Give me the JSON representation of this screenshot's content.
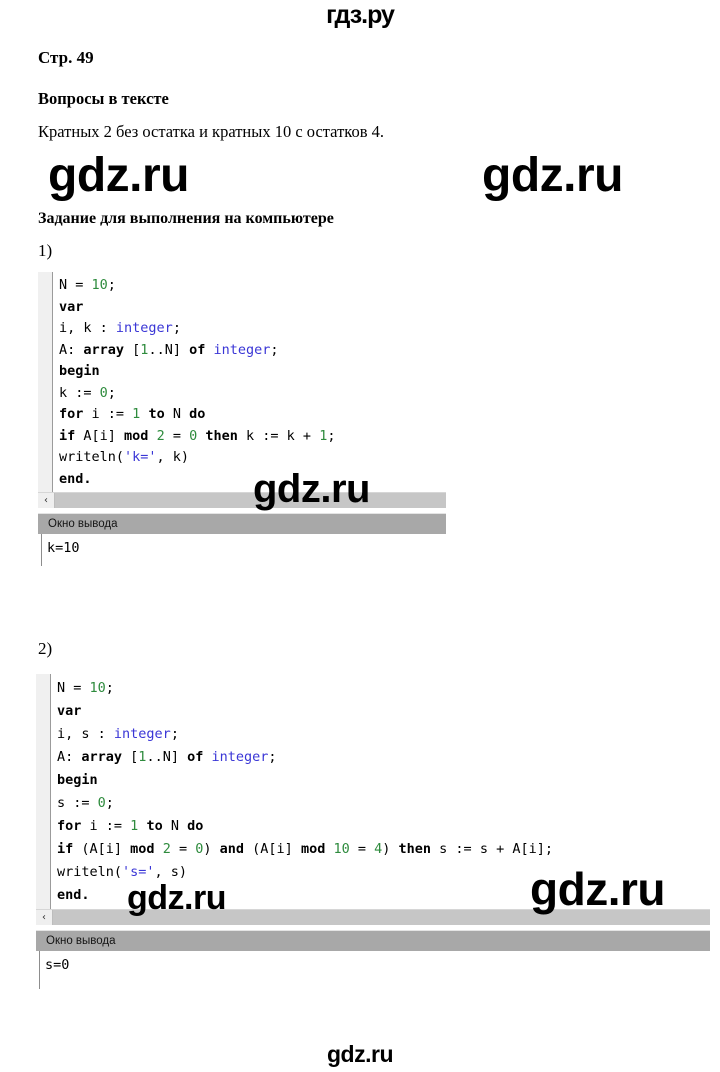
{
  "site": {
    "logo_top": "гдз.ру",
    "watermark": "gdz.ru"
  },
  "document": {
    "page_label": "Стр. 49",
    "heading_questions": "Вопросы в тексте",
    "answer_text": "Кратных 2 без остатка и кратных 10 с остатков 4.",
    "heading_task": "Задание для выполнения на компьютере",
    "item_1_marker": "1)",
    "item_2_marker": "2)"
  },
  "editor_1": {
    "scrollbar_arrow": "‹",
    "output_title": "Окно вывода",
    "output_value": "k=10",
    "code": [
      [
        {
          "t": "N = ",
          "c": "pl"
        },
        {
          "t": "10",
          "c": "num"
        },
        {
          "t": ";",
          "c": "pl"
        }
      ],
      [
        {
          "t": "var",
          "c": "kw"
        }
      ],
      [
        {
          "t": "i, k : ",
          "c": "pl"
        },
        {
          "t": "integer",
          "c": "typ"
        },
        {
          "t": ";",
          "c": "pl"
        }
      ],
      [
        {
          "t": "A: ",
          "c": "pl"
        },
        {
          "t": "array",
          "c": "kw"
        },
        {
          "t": " [",
          "c": "pl"
        },
        {
          "t": "1",
          "c": "num"
        },
        {
          "t": "..N] ",
          "c": "pl"
        },
        {
          "t": "of",
          "c": "kw"
        },
        {
          "t": " ",
          "c": "pl"
        },
        {
          "t": "integer",
          "c": "typ"
        },
        {
          "t": ";",
          "c": "pl"
        }
      ],
      [
        {
          "t": "begin",
          "c": "kw"
        }
      ],
      [
        {
          "t": "k := ",
          "c": "pl"
        },
        {
          "t": "0",
          "c": "num"
        },
        {
          "t": ";",
          "c": "pl"
        }
      ],
      [
        {
          "t": "for",
          "c": "kw"
        },
        {
          "t": " i := ",
          "c": "pl"
        },
        {
          "t": "1",
          "c": "num"
        },
        {
          "t": " ",
          "c": "pl"
        },
        {
          "t": "to",
          "c": "kw"
        },
        {
          "t": " N ",
          "c": "pl"
        },
        {
          "t": "do",
          "c": "kw"
        }
      ],
      [
        {
          "t": "if",
          "c": "kw"
        },
        {
          "t": " A[i] ",
          "c": "pl"
        },
        {
          "t": "mod",
          "c": "kw"
        },
        {
          "t": " ",
          "c": "pl"
        },
        {
          "t": "2",
          "c": "num"
        },
        {
          "t": " = ",
          "c": "pl"
        },
        {
          "t": "0",
          "c": "num"
        },
        {
          "t": " ",
          "c": "pl"
        },
        {
          "t": "then",
          "c": "kw"
        },
        {
          "t": " k := k + ",
          "c": "pl"
        },
        {
          "t": "1",
          "c": "num"
        },
        {
          "t": ";",
          "c": "pl"
        }
      ],
      [
        {
          "t": "writeln(",
          "c": "pl"
        },
        {
          "t": "'k='",
          "c": "str"
        },
        {
          "t": ", k)",
          "c": "pl"
        }
      ],
      [
        {
          "t": "end.",
          "c": "kw"
        }
      ]
    ]
  },
  "editor_2": {
    "scrollbar_arrow": "‹",
    "output_title": "Окно вывода",
    "output_value": "s=0",
    "code": [
      [
        {
          "t": "N = ",
          "c": "pl"
        },
        {
          "t": "10",
          "c": "num"
        },
        {
          "t": ";",
          "c": "pl"
        }
      ],
      [
        {
          "t": "var",
          "c": "kw"
        }
      ],
      [
        {
          "t": "i, s : ",
          "c": "pl"
        },
        {
          "t": "integer",
          "c": "typ"
        },
        {
          "t": ";",
          "c": "pl"
        }
      ],
      [
        {
          "t": "A: ",
          "c": "pl"
        },
        {
          "t": "array",
          "c": "kw"
        },
        {
          "t": " [",
          "c": "pl"
        },
        {
          "t": "1",
          "c": "num"
        },
        {
          "t": "..N] ",
          "c": "pl"
        },
        {
          "t": "of",
          "c": "kw"
        },
        {
          "t": " ",
          "c": "pl"
        },
        {
          "t": "integer",
          "c": "typ"
        },
        {
          "t": ";",
          "c": "pl"
        }
      ],
      [
        {
          "t": "begin",
          "c": "kw"
        }
      ],
      [
        {
          "t": "s := ",
          "c": "pl"
        },
        {
          "t": "0",
          "c": "num"
        },
        {
          "t": ";",
          "c": "pl"
        }
      ],
      [
        {
          "t": "for",
          "c": "kw"
        },
        {
          "t": " i := ",
          "c": "pl"
        },
        {
          "t": "1",
          "c": "num"
        },
        {
          "t": " ",
          "c": "pl"
        },
        {
          "t": "to",
          "c": "kw"
        },
        {
          "t": " N ",
          "c": "pl"
        },
        {
          "t": "do",
          "c": "kw"
        }
      ],
      [
        {
          "t": "if",
          "c": "kw"
        },
        {
          "t": " (A[i] ",
          "c": "pl"
        },
        {
          "t": "mod",
          "c": "kw"
        },
        {
          "t": " ",
          "c": "pl"
        },
        {
          "t": "2",
          "c": "num"
        },
        {
          "t": " = ",
          "c": "pl"
        },
        {
          "t": "0",
          "c": "num"
        },
        {
          "t": ") ",
          "c": "pl"
        },
        {
          "t": "and",
          "c": "kw"
        },
        {
          "t": " (A[i] ",
          "c": "pl"
        },
        {
          "t": "mod",
          "c": "kw"
        },
        {
          "t": " ",
          "c": "pl"
        },
        {
          "t": "10",
          "c": "num"
        },
        {
          "t": " = ",
          "c": "pl"
        },
        {
          "t": "4",
          "c": "num"
        },
        {
          "t": ") ",
          "c": "pl"
        },
        {
          "t": "then",
          "c": "kw"
        },
        {
          "t": " s := s + A[i];",
          "c": "pl"
        }
      ],
      [
        {
          "t": "writeln(",
          "c": "pl"
        },
        {
          "t": "'s='",
          "c": "str"
        },
        {
          "t": ", s)",
          "c": "pl"
        }
      ],
      [
        {
          "t": "end.",
          "c": "kw"
        }
      ]
    ]
  }
}
